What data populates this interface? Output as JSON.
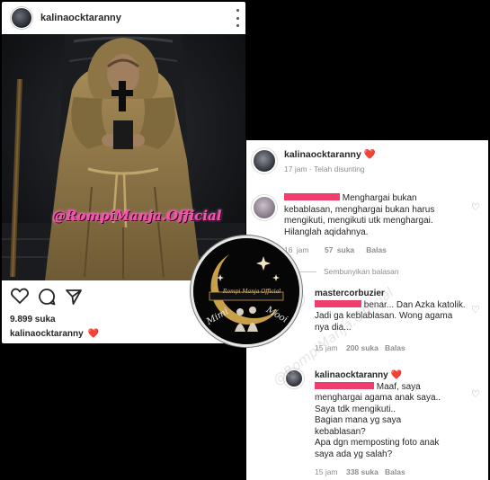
{
  "post": {
    "username": "kalinaocktaranny",
    "photo_watermark": "@RompiManja.Official",
    "likes": "9.899 suka",
    "caption_user": "kalinaocktaranny",
    "caption_emoji": "❤️",
    "icons": [
      "heart-icon",
      "comment-icon",
      "share-icon",
      "bookmark-icon",
      "more-options-icon"
    ]
  },
  "comments_panel": {
    "header": {
      "username": "kalinaocktaranny",
      "emoji": "❤️",
      "time": "17 jam",
      "separator": "·",
      "edited": "Telah disunting"
    },
    "comment1": {
      "text_first": "Menghargai bukan",
      "text_rest": "kebablasan, menghargai bukan harus mengikuti, mengikuti utk menghargai. Hilanglah aqidahnya.",
      "time": "16 jam",
      "likes": "57 suka",
      "reply": "Balas"
    },
    "hide_replies": "Sembunyikan balasan",
    "reply1": {
      "username": "mastercorbuzier",
      "text_first": "benar... Dan Azka",
      "text_rest": "katolik. Jadi ga keblablasan. Wong agama nya dia...",
      "time": "15 jam",
      "likes": "200 suka",
      "reply": "Balas"
    },
    "reply2": {
      "username": "kalinaocktaranny",
      "emoji": "❤️",
      "text_first": "Maaf, saya",
      "lines": [
        "menghargai agama anak saya..",
        "Saya tdk mengikuti..",
        "Bagian mana yg saya",
        "kebablasan?",
        "Apa dgn memposting foto anak",
        "saya ada yg salah?"
      ],
      "time": "15 jam",
      "likes": "338 suka",
      "reply": "Balas"
    }
  },
  "logo": {
    "top_text": "Mimi",
    "bottom_text": "Mooi",
    "banner_text": "Rompi Manja Official"
  },
  "diagonal_watermark": "@RompiManja.Official",
  "colors": {
    "redaction": "#ef3d6e",
    "like_heart": "#e0245e",
    "meta_gray": "#8e8e8e",
    "photo_watermark": "#ff4db8",
    "moon_gold": "#c9a04a"
  }
}
